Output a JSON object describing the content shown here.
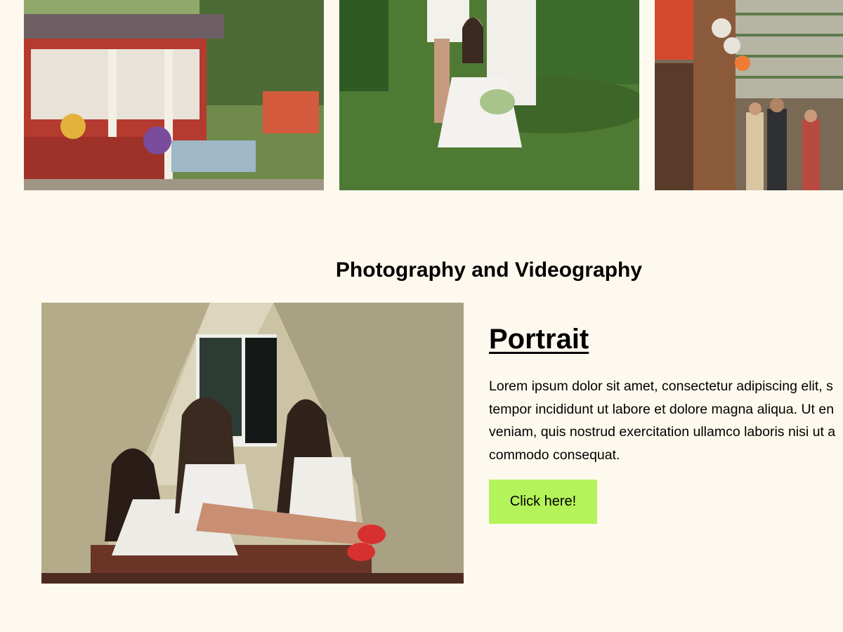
{
  "gallery": {
    "photos": [
      {
        "alt": "farm stand photo"
      },
      {
        "alt": "women in white dresses photo"
      },
      {
        "alt": "market street photo"
      }
    ]
  },
  "section": {
    "title": "Photography and Videography",
    "feature": {
      "heading": "Portrait",
      "body_lines": [
        "Lorem ipsum dolor sit amet, consectetur adipiscing elit, s",
        "tempor incididunt ut labore et dolore magna aliqua. Ut en",
        "veniam, quis nostrud exercitation ullamco laboris nisi ut a",
        "commodo consequat."
      ],
      "button_label": "Click here!"
    }
  },
  "colors": {
    "background": "#fdf9ee",
    "button": "#b4f35a",
    "text": "#000000"
  }
}
